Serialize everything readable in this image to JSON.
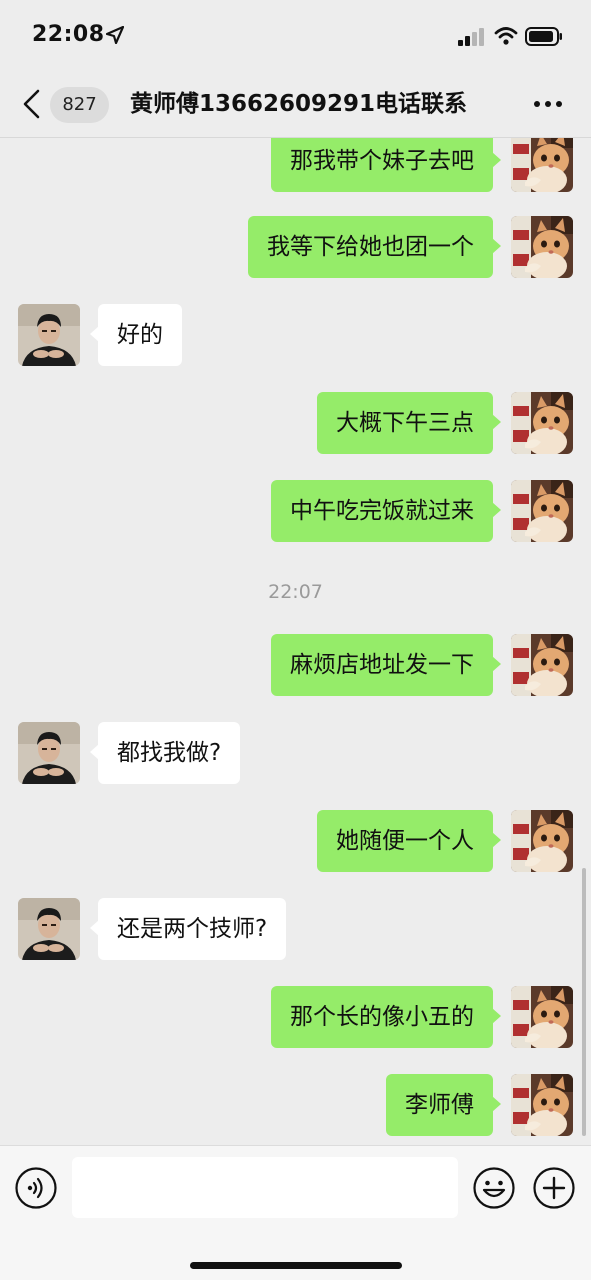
{
  "status_bar": {
    "time": "22:08",
    "location_icon": "location-arrow-icon",
    "signal_icon": "cellular-signal-icon",
    "wifi_icon": "wifi-icon",
    "battery_icon": "battery-icon"
  },
  "header": {
    "back_icon": "chevron-left-icon",
    "unread_count": "827",
    "title": "黄师傅13662609291电话联系",
    "more_icon": "more-dots-icon"
  },
  "messages": [
    {
      "sender": "self",
      "text": "那我带个妹子去吧",
      "avatar": "cat-avatar"
    },
    {
      "sender": "self",
      "text": "我等下给她也团一个",
      "avatar": "cat-avatar"
    },
    {
      "sender": "other",
      "text": "好的",
      "avatar": "contact-avatar"
    },
    {
      "sender": "self",
      "text": "大概下午三点",
      "avatar": "cat-avatar"
    },
    {
      "sender": "self",
      "text": "中午吃完饭就过来",
      "avatar": "cat-avatar"
    },
    {
      "type": "timestamp",
      "text": "22:07"
    },
    {
      "sender": "self",
      "text": "麻烦店地址发一下",
      "avatar": "cat-avatar"
    },
    {
      "sender": "other",
      "text": "都找我做?",
      "avatar": "contact-avatar"
    },
    {
      "sender": "self",
      "text": "她随便一个人",
      "avatar": "cat-avatar"
    },
    {
      "sender": "other",
      "text": "还是两个技师?",
      "avatar": "contact-avatar"
    },
    {
      "sender": "self",
      "text": "那个长的像小五的",
      "avatar": "cat-avatar"
    },
    {
      "sender": "self",
      "text": "李师傅",
      "avatar": "cat-avatar"
    }
  ],
  "input_bar": {
    "voice_icon": "voice-icon",
    "input_value": "",
    "emoji_icon": "emoji-icon",
    "plus_icon": "plus-circle-icon"
  },
  "colors": {
    "background": "#ededed",
    "self_bubble": "#95ec69",
    "other_bubble": "#ffffff",
    "timestamp": "#9a9a9a",
    "input_bar": "#f6f6f6"
  }
}
